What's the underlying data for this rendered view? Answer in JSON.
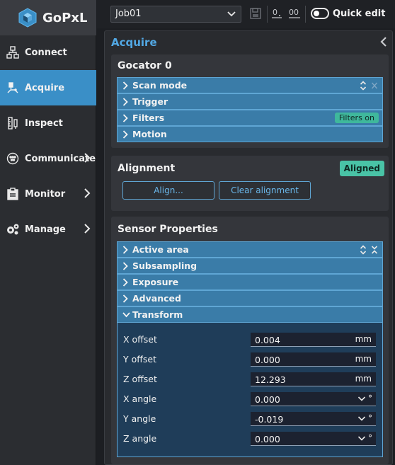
{
  "app": {
    "name": "GoPxL"
  },
  "sidebar": {
    "items": [
      {
        "label": "Connect",
        "icon": "network-icon",
        "active": false,
        "has_submenu": false
      },
      {
        "label": "Acquire",
        "icon": "acquire-icon",
        "active": true,
        "has_submenu": false
      },
      {
        "label": "Inspect",
        "icon": "ruler-icon",
        "active": false,
        "has_submenu": false
      },
      {
        "label": "Communicate",
        "icon": "plug-icon",
        "active": false,
        "has_submenu": true
      },
      {
        "label": "Monitor",
        "icon": "clipboard-icon",
        "active": false,
        "has_submenu": true
      },
      {
        "label": "Manage",
        "icon": "gears-icon",
        "active": false,
        "has_submenu": true
      }
    ]
  },
  "toolbar": {
    "job": "Job01",
    "quick_edit_label": "Quick edit",
    "quick_edit_on": false
  },
  "panel": {
    "title": "Acquire",
    "sensor": {
      "title": "Gocator 0",
      "rows": [
        {
          "label": "Scan mode"
        },
        {
          "label": "Trigger"
        },
        {
          "label": "Filters",
          "badge": "Filters on"
        },
        {
          "label": "Motion"
        }
      ]
    },
    "alignment": {
      "title": "Alignment",
      "status": "Aligned",
      "align_button": "Align...",
      "clear_button": "Clear alignment"
    },
    "sensor_properties": {
      "title": "Sensor Properties",
      "rows": [
        {
          "label": "Active area"
        },
        {
          "label": "Subsampling"
        },
        {
          "label": "Exposure"
        },
        {
          "label": "Advanced"
        },
        {
          "label": "Transform"
        }
      ],
      "transform": [
        {
          "label": "X offset",
          "value": "0.004",
          "unit": "mm"
        },
        {
          "label": "Y offset",
          "value": "0.000",
          "unit": "mm"
        },
        {
          "label": "Z offset",
          "value": "12.293",
          "unit": "mm"
        },
        {
          "label": "X angle",
          "value": "0.000",
          "unit": "°"
        },
        {
          "label": "Y angle",
          "value": "-0.019",
          "unit": "°"
        },
        {
          "label": "Z angle",
          "value": "0.000",
          "unit": "°"
        }
      ]
    }
  },
  "colors": {
    "accent": "#3a8fc7",
    "row_blue": "#3a7ca8",
    "badge_green": "#49c3a6",
    "title_blue": "#52a8e4"
  }
}
